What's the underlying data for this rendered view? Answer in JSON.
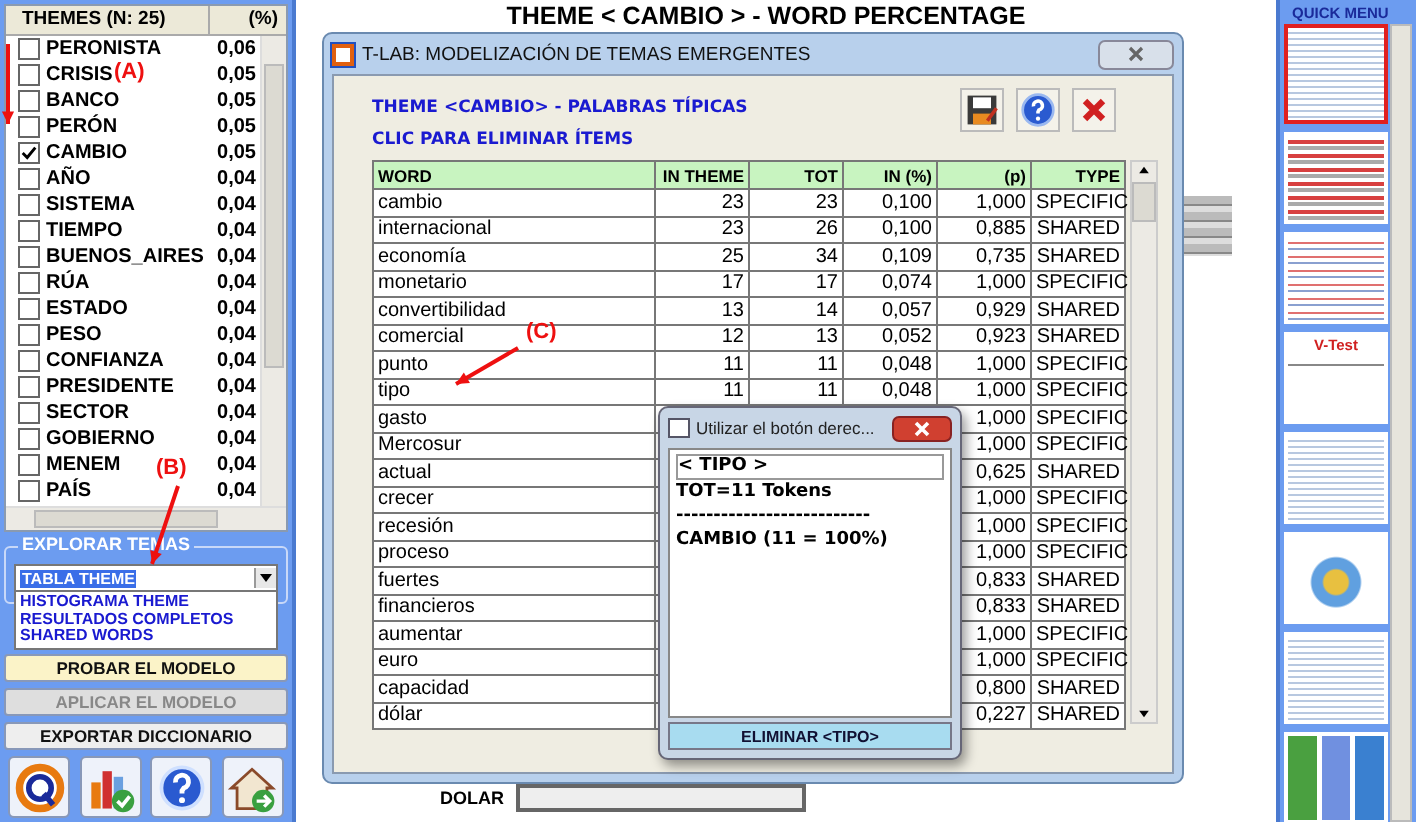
{
  "themes_list": {
    "header": "THEMES (N: 25)",
    "header_value": "(%)",
    "items": [
      {
        "label": "PERONISTA",
        "value": "0,06",
        "checked": false
      },
      {
        "label": "CRISIS",
        "value": "0,05",
        "checked": false
      },
      {
        "label": "BANCO",
        "value": "0,05",
        "checked": false
      },
      {
        "label": "PERÓN",
        "value": "0,05",
        "checked": false
      },
      {
        "label": "CAMBIO",
        "value": "0,05",
        "checked": true
      },
      {
        "label": "AÑO",
        "value": "0,04",
        "checked": false
      },
      {
        "label": "SISTEMA",
        "value": "0,04",
        "checked": false
      },
      {
        "label": "TIEMPO",
        "value": "0,04",
        "checked": false
      },
      {
        "label": "BUENOS_AIRES",
        "value": "0,04",
        "checked": false
      },
      {
        "label": "RÚA",
        "value": "0,04",
        "checked": false
      },
      {
        "label": "ESTADO",
        "value": "0,04",
        "checked": false
      },
      {
        "label": "PESO",
        "value": "0,04",
        "checked": false
      },
      {
        "label": "CONFIANZA",
        "value": "0,04",
        "checked": false
      },
      {
        "label": "PRESIDENTE",
        "value": "0,04",
        "checked": false
      },
      {
        "label": "SECTOR",
        "value": "0,04",
        "checked": false
      },
      {
        "label": "GOBIERNO",
        "value": "0,04",
        "checked": false
      },
      {
        "label": "MENEM",
        "value": "0,04",
        "checked": false
      },
      {
        "label": "PAÍS",
        "value": "0,04",
        "checked": false
      }
    ]
  },
  "explore": {
    "title": "EXPLORAR TEMAS",
    "value": "TABLA THEME",
    "open": true,
    "options": [
      "HISTOGRAMA THEME",
      "RESULTADOS COMPLETOS",
      "SHARED WORDS"
    ]
  },
  "buttons": [
    {
      "label": "PROBAR EL MODELO",
      "disabled": false,
      "highlighted": true
    },
    {
      "label": "APLICAR EL MODELO",
      "disabled": true,
      "highlighted": false
    },
    {
      "label": "EXPORTAR DICCIONARIO",
      "disabled": false,
      "highlighted": false
    }
  ],
  "toolbar": [
    {
      "kind": "ring"
    },
    {
      "kind": "chart"
    },
    {
      "kind": "help"
    },
    {
      "kind": "home"
    }
  ],
  "page_title": "THEME < CAMBIO > - WORD PERCENTAGE",
  "background_chart": {
    "label": "DOLAR"
  },
  "window": {
    "title": "T-LAB: MODELIZACIÓN DE TEMAS EMERGENTES",
    "heading": "THEME <CAMBIO> - PALABRAS TÍPICAS",
    "hint": "CLIC PARA ELIMINAR ÍTEMS",
    "table": {
      "columns": [
        "WORD",
        "IN THEME",
        "TOT",
        "IN (%)",
        "(p)",
        "TYPE"
      ],
      "rows": [
        {
          "word": "cambio",
          "in_theme": "23",
          "tot": "23",
          "in_pct": "0,100",
          "p": "1,000",
          "type": "SPECIFIC"
        },
        {
          "word": "internacional",
          "in_theme": "23",
          "tot": "26",
          "in_pct": "0,100",
          "p": "0,885",
          "type": "SHARED"
        },
        {
          "word": "economía",
          "in_theme": "25",
          "tot": "34",
          "in_pct": "0,109",
          "p": "0,735",
          "type": "SHARED"
        },
        {
          "word": "monetario",
          "in_theme": "17",
          "tot": "17",
          "in_pct": "0,074",
          "p": "1,000",
          "type": "SPECIFIC"
        },
        {
          "word": "convertibilidad",
          "in_theme": "13",
          "tot": "14",
          "in_pct": "0,057",
          "p": "0,929",
          "type": "SHARED"
        },
        {
          "word": "comercial",
          "in_theme": "12",
          "tot": "13",
          "in_pct": "0,052",
          "p": "0,923",
          "type": "SHARED"
        },
        {
          "word": "punto",
          "in_theme": "11",
          "tot": "11",
          "in_pct": "0,048",
          "p": "1,000",
          "type": "SPECIFIC"
        },
        {
          "word": "tipo",
          "in_theme": "11",
          "tot": "11",
          "in_pct": "0,048",
          "p": "1,000",
          "type": "SPECIFIC"
        },
        {
          "word": "gasto",
          "p": "1,000",
          "type": "SPECIFIC"
        },
        {
          "word": "Mercosur",
          "p": "1,000",
          "type": "SPECIFIC"
        },
        {
          "word": "actual",
          "p": "0,625",
          "type": "SHARED"
        },
        {
          "word": "crecer",
          "p": "1,000",
          "type": "SPECIFIC"
        },
        {
          "word": "recesión",
          "p": "1,000",
          "type": "SPECIFIC"
        },
        {
          "word": "proceso",
          "p": "1,000",
          "type": "SPECIFIC"
        },
        {
          "word": "fuertes",
          "p": "0,833",
          "type": "SHARED"
        },
        {
          "word": "financieros",
          "p": "0,833",
          "type": "SHARED"
        },
        {
          "word": "aumentar",
          "p": "1,000",
          "type": "SPECIFIC"
        },
        {
          "word": "euro",
          "p": "1,000",
          "type": "SPECIFIC"
        },
        {
          "word": "capacidad",
          "p": "0,800",
          "type": "SHARED"
        },
        {
          "word": "dólar",
          "p": "0,227",
          "type": "SHARED"
        }
      ]
    }
  },
  "popup": {
    "title": "Utilizar el botón derec...",
    "lines": [
      "< TIPO >",
      "TOT=11  Tokens",
      "--------------------------",
      "CAMBIO (11 = 100%)"
    ],
    "button": "ELIMINAR <TIPO>"
  },
  "quick_menu": {
    "title": "QUICK MENU",
    "thumbnails": [
      {
        "kind": "table",
        "selected": true
      },
      {
        "kind": "bars",
        "selected": false
      },
      {
        "kind": "text",
        "selected": false
      },
      {
        "kind": "vtest",
        "label": "V-Test",
        "selected": false
      },
      {
        "kind": "table",
        "selected": false
      },
      {
        "kind": "scatter",
        "selected": false
      },
      {
        "kind": "table",
        "selected": false
      },
      {
        "kind": "grid",
        "selected": false
      }
    ]
  },
  "annotations": [
    {
      "label": "(A)"
    },
    {
      "label": "(B)"
    },
    {
      "label": "(C)"
    }
  ]
}
